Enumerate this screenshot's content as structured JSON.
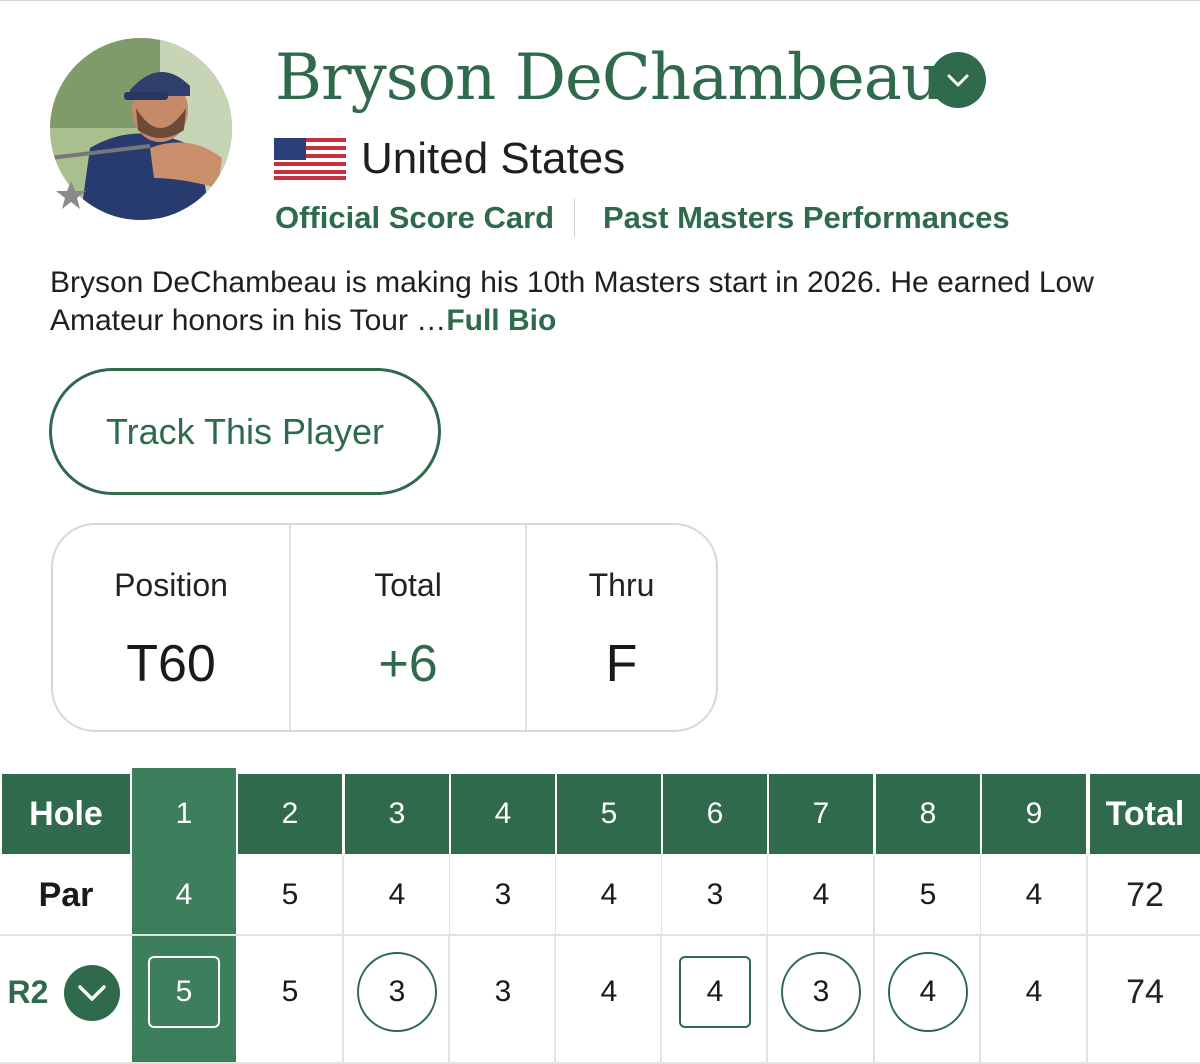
{
  "player": {
    "name": "Bryson DeChambeau",
    "country": "United States",
    "flag_icon": "us-flag-icon",
    "avatar_alt": "player-photo"
  },
  "links": {
    "scorecard": "Official Score Card",
    "past": "Past Masters Performances"
  },
  "bio": {
    "text": "Bryson DeChambeau is making his 10th Masters start in 2026. He earned Low Amateur honors in his Tour …",
    "more_label": "Full Bio"
  },
  "track_button": "Track This Player",
  "stats": [
    {
      "label": "Position",
      "value": "T60"
    },
    {
      "label": "Total",
      "value": "+6"
    },
    {
      "label": "Thru",
      "value": "F"
    }
  ],
  "scorecard": {
    "header_label": "Hole",
    "total_label": "Total",
    "holes": [
      "1",
      "2",
      "3",
      "4",
      "5",
      "6",
      "7",
      "8",
      "9"
    ],
    "par_label": "Par",
    "par": [
      "4",
      "5",
      "4",
      "3",
      "4",
      "3",
      "4",
      "5",
      "4"
    ],
    "par_total": "72",
    "round_label": "R2",
    "round": [
      "5",
      "5",
      "3",
      "3",
      "4",
      "4",
      "3",
      "4",
      "4"
    ],
    "round_total": "74",
    "highlight_hole": "1"
  },
  "colors": {
    "brand_green": "#2e6a4b",
    "highlight_green": "#3d7f5c"
  },
  "icons": {
    "name_dropdown": "chevron-down-icon",
    "round_dropdown": "chevron-down-icon",
    "favorite": "star-icon"
  }
}
